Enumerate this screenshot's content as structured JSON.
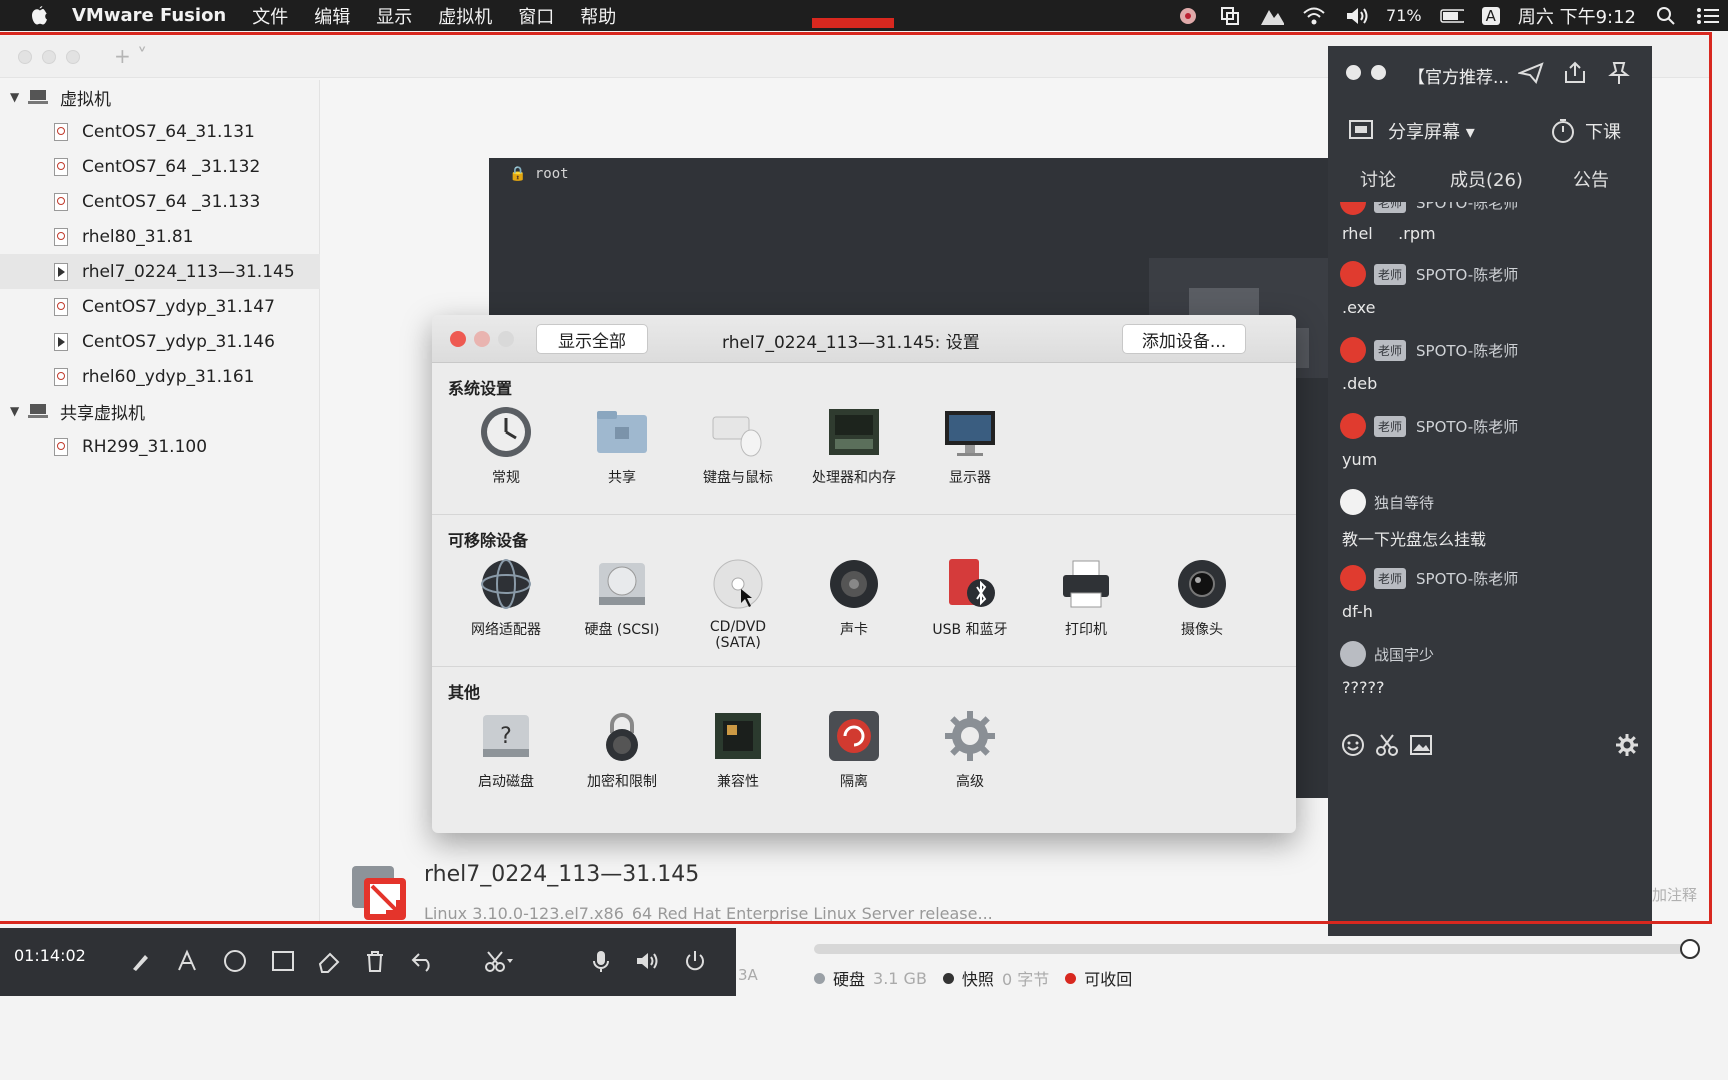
{
  "menubar": {
    "app_name": "VMware Fusion",
    "menus": [
      "文件",
      "编辑",
      "显示",
      "虚拟机",
      "窗口",
      "帮助"
    ],
    "battery": "71%",
    "input_method": "A",
    "clock": "周六 下午9:12"
  },
  "library": {
    "groups": [
      {
        "label": "虚拟机"
      },
      {
        "label": "共享虚拟机"
      }
    ],
    "vms": [
      {
        "name": "CentOS7_64_31.131",
        "state": "off"
      },
      {
        "name": "CentOS7_64 _31.132",
        "state": "off"
      },
      {
        "name": "CentOS7_64 _31.133",
        "state": "off"
      },
      {
        "name": "rhel80_31.81",
        "state": "off"
      },
      {
        "name": "rhel7_0224_113—31.145",
        "state": "running",
        "selected": true
      },
      {
        "name": "CentOS7_ydyp_31.147",
        "state": "off"
      },
      {
        "name": "CentOS7_ydyp_31.146",
        "state": "running"
      },
      {
        "name": "rhel60_ydyp_31.161",
        "state": "off"
      }
    ],
    "shared_vms": [
      {
        "name": "RH299_31.100",
        "state": "off"
      }
    ],
    "console_user": "root",
    "vm_info": {
      "name": "rhel7_0224_113—31.145",
      "description": "Linux 3.10.0-123.el7.x86_64 Red Hat Enterprise Linux Server release..."
    },
    "annot_hint": "加注释",
    "partial_label": "3A"
  },
  "settings": {
    "show_all": "显示全部",
    "title": "rhel7_0224_113—31.145: 设置",
    "add_device": "添加设备...",
    "sections": [
      {
        "title": "系统设置",
        "items": [
          {
            "label": "常规",
            "icon": "general-icon"
          },
          {
            "label": "共享",
            "icon": "sharing-folder-icon"
          },
          {
            "label": "键盘与鼠标",
            "icon": "keyboard-mouse-icon"
          },
          {
            "label": "处理器和内存",
            "icon": "processor-memory-icon"
          },
          {
            "label": "显示器",
            "icon": "display-icon"
          }
        ]
      },
      {
        "title": "可移除设备",
        "items": [
          {
            "label": "网络适配器",
            "icon": "network-adapter-icon"
          },
          {
            "label": "硬盘 (SCSI)",
            "icon": "hard-disk-icon"
          },
          {
            "label": "CD/DVD\n(SATA)",
            "icon": "cd-dvd-icon"
          },
          {
            "label": "声卡",
            "icon": "sound-card-icon"
          },
          {
            "label": "USB 和蓝牙",
            "icon": "usb-bluetooth-icon"
          },
          {
            "label": "打印机",
            "icon": "printer-icon"
          },
          {
            "label": "摄像头",
            "icon": "camera-icon"
          }
        ]
      },
      {
        "title": "其他",
        "items": [
          {
            "label": "启动磁盘",
            "icon": "startup-disk-icon"
          },
          {
            "label": "加密和限制",
            "icon": "encryption-lock-icon"
          },
          {
            "label": "兼容性",
            "icon": "compatibility-chip-icon"
          },
          {
            "label": "隔离",
            "icon": "isolation-icon"
          },
          {
            "label": "高级",
            "icon": "advanced-gear-icon"
          }
        ]
      }
    ]
  },
  "status": {
    "disk_label": "硬盘",
    "disk_value": "3.1 GB",
    "snapshot_label": "快照",
    "snapshot_value": "0 字节",
    "reclaim_label": "可收回",
    "disk_color": "#9aa0a6",
    "snapshot_color": "#333333",
    "reclaim_color": "#d8281f"
  },
  "recorder": {
    "time": "01:14:02",
    "tools": [
      "pen-icon",
      "text-icon",
      "circle-icon",
      "rectangle-icon",
      "eraser-icon",
      "trash-icon",
      "undo-icon",
      "scissors-icon",
      "microphone-icon",
      "speaker-icon",
      "power-icon"
    ]
  },
  "chat": {
    "title": "【官方推荐...",
    "share_screen": "分享屏幕",
    "end_class": "下课",
    "tabs": [
      "讨论",
      "成员(26)",
      "公告"
    ],
    "messages": [
      {
        "user": "SPOTO-陈老师",
        "badge": "老师",
        "text": "rhel     .rpm"
      },
      {
        "user": "SPOTO-陈老师",
        "badge": "老师",
        "text": ".exe"
      },
      {
        "user": "SPOTO-陈老师",
        "badge": "老师",
        "text": ".deb"
      },
      {
        "user": "SPOTO-陈老师",
        "badge": "老师",
        "text": "yum"
      },
      {
        "user": "独自等待",
        "badge": "",
        "text": "教一下光盘怎么挂载"
      },
      {
        "user": "SPOTO-陈老师",
        "badge": "老师",
        "text": "df-h"
      },
      {
        "user": "战国宇少",
        "badge": "",
        "text": "?????"
      }
    ]
  }
}
